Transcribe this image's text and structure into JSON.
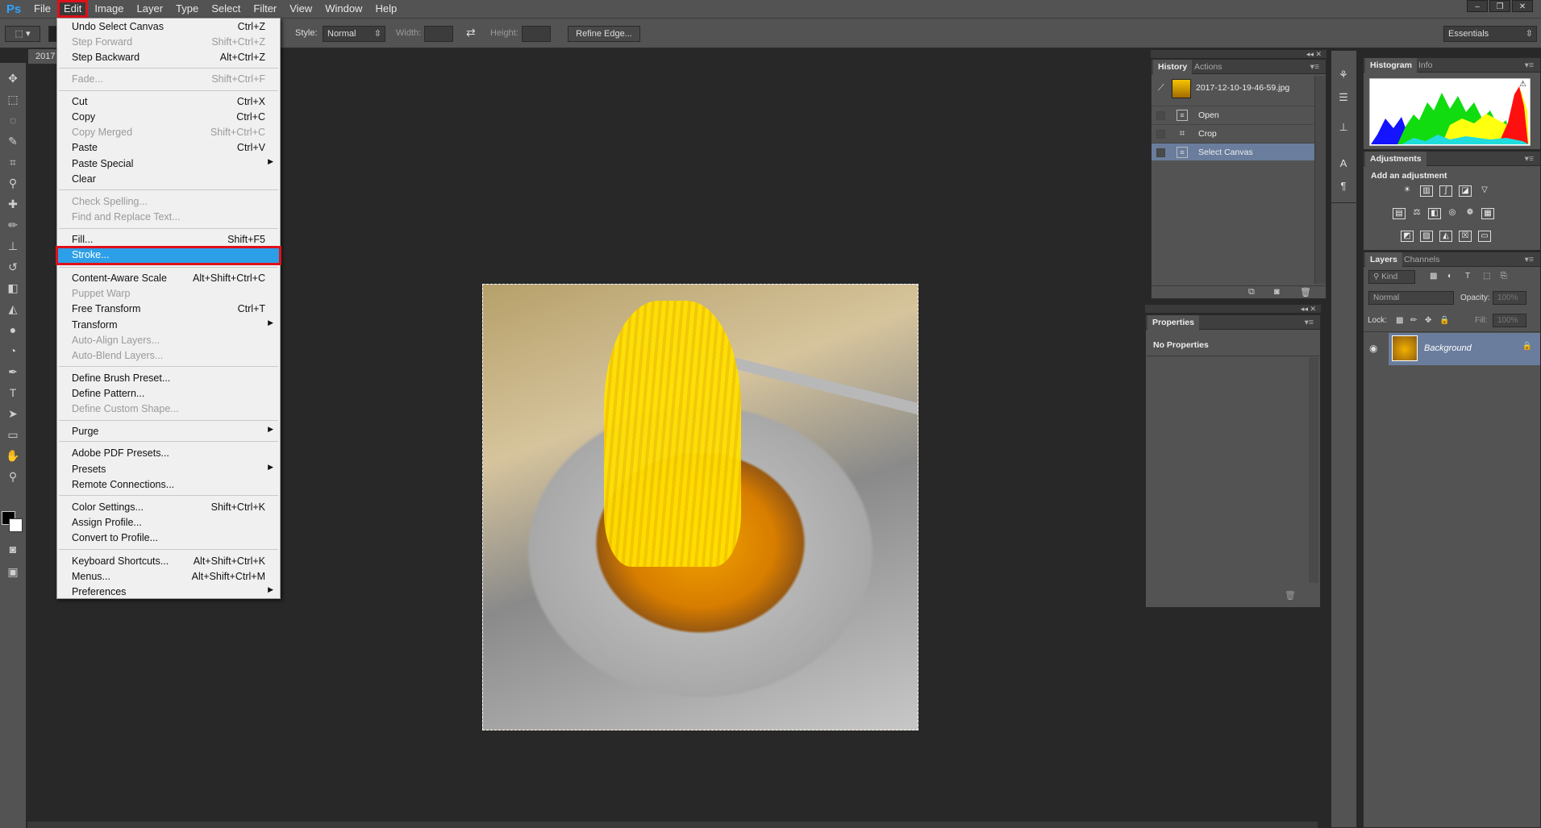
{
  "app": {
    "logo": "Ps"
  },
  "menubar": {
    "items": [
      "File",
      "Edit",
      "Image",
      "Layer",
      "Type",
      "Select",
      "Filter",
      "View",
      "Window",
      "Help"
    ],
    "active": "Edit"
  },
  "window_controls": {
    "minimize": "–",
    "restore": "❐",
    "close": "✕"
  },
  "options": {
    "style_label": "Style:",
    "style_value": "Normal",
    "width_label": "Width:",
    "height_label": "Height:",
    "refine_edge": "Refine Edge...",
    "workspace": "Essentials"
  },
  "document": {
    "tab_label": "2017"
  },
  "edit_menu": {
    "items": [
      {
        "label": "Undo Select Canvas",
        "shortcut": "Ctrl+Z"
      },
      {
        "label": "Step Forward",
        "shortcut": "Shift+Ctrl+Z",
        "disabled": true
      },
      {
        "label": "Step Backward",
        "shortcut": "Alt+Ctrl+Z"
      },
      {
        "label": "Fade...",
        "shortcut": "Shift+Ctrl+F",
        "disabled": true
      },
      {
        "label": "Cut",
        "shortcut": "Ctrl+X"
      },
      {
        "label": "Copy",
        "shortcut": "Ctrl+C"
      },
      {
        "label": "Copy Merged",
        "shortcut": "Shift+Ctrl+C",
        "disabled": true
      },
      {
        "label": "Paste",
        "shortcut": "Ctrl+V"
      },
      {
        "label": "Paste Special",
        "shortcut": "",
        "submenu": true
      },
      {
        "label": "Clear",
        "shortcut": ""
      },
      {
        "label": "Check Spelling...",
        "shortcut": "",
        "disabled": true
      },
      {
        "label": "Find and Replace Text...",
        "shortcut": "",
        "disabled": true
      },
      {
        "label": "Fill...",
        "shortcut": "Shift+F5"
      },
      {
        "label": "Stroke...",
        "shortcut": "",
        "highlighted": true
      },
      {
        "label": "Content-Aware Scale",
        "shortcut": "Alt+Shift+Ctrl+C"
      },
      {
        "label": "Puppet Warp",
        "shortcut": "",
        "disabled": true
      },
      {
        "label": "Free Transform",
        "shortcut": "Ctrl+T"
      },
      {
        "label": "Transform",
        "shortcut": "",
        "submenu": true
      },
      {
        "label": "Auto-Align Layers...",
        "shortcut": "",
        "disabled": true
      },
      {
        "label": "Auto-Blend Layers...",
        "shortcut": "",
        "disabled": true
      },
      {
        "label": "Define Brush Preset...",
        "shortcut": ""
      },
      {
        "label": "Define Pattern...",
        "shortcut": ""
      },
      {
        "label": "Define Custom Shape...",
        "shortcut": "",
        "disabled": true
      },
      {
        "label": "Purge",
        "shortcut": "",
        "submenu": true
      },
      {
        "label": "Adobe PDF Presets...",
        "shortcut": ""
      },
      {
        "label": "Presets",
        "shortcut": "",
        "submenu": true
      },
      {
        "label": "Remote Connections...",
        "shortcut": ""
      },
      {
        "label": "Color Settings...",
        "shortcut": "Shift+Ctrl+K"
      },
      {
        "label": "Assign Profile...",
        "shortcut": ""
      },
      {
        "label": "Convert to Profile...",
        "shortcut": ""
      },
      {
        "label": "Keyboard Shortcuts...",
        "shortcut": "Alt+Shift+Ctrl+K"
      },
      {
        "label": "Menus...",
        "shortcut": "Alt+Shift+Ctrl+M"
      },
      {
        "label": "Preferences",
        "shortcut": "",
        "submenu": true
      }
    ]
  },
  "history_panel": {
    "tabs": [
      "History",
      "Actions"
    ],
    "snapshot": "2017-12-10-19-46-59.jpg",
    "states": [
      "Open",
      "Crop",
      "Select Canvas"
    ],
    "selected_state": "Select Canvas"
  },
  "properties_panel": {
    "title": "Properties",
    "message": "No Properties"
  },
  "histogram_panel": {
    "tabs": [
      "Histogram",
      "Info"
    ]
  },
  "adjustments_panel": {
    "title": "Adjustments",
    "subtitle": "Add an adjustment"
  },
  "layers_panel": {
    "tabs": [
      "Layers",
      "Channels"
    ],
    "kind_filter": "Kind",
    "blend_mode": "Normal",
    "opacity_label": "Opacity:",
    "opacity_value": "100%",
    "lock_label": "Lock:",
    "fill_label": "Fill:",
    "fill_value": "100%",
    "layers": [
      {
        "name": "Background",
        "locked": true,
        "visible": true
      }
    ]
  },
  "colors": {
    "panel_bg": "#535353",
    "workspace_bg": "#282828",
    "menu_bg": "#f0f0f0",
    "highlight": "#2d9fe8",
    "annotation_red": "#e0101a",
    "history_selected": "#6a7d9d"
  }
}
